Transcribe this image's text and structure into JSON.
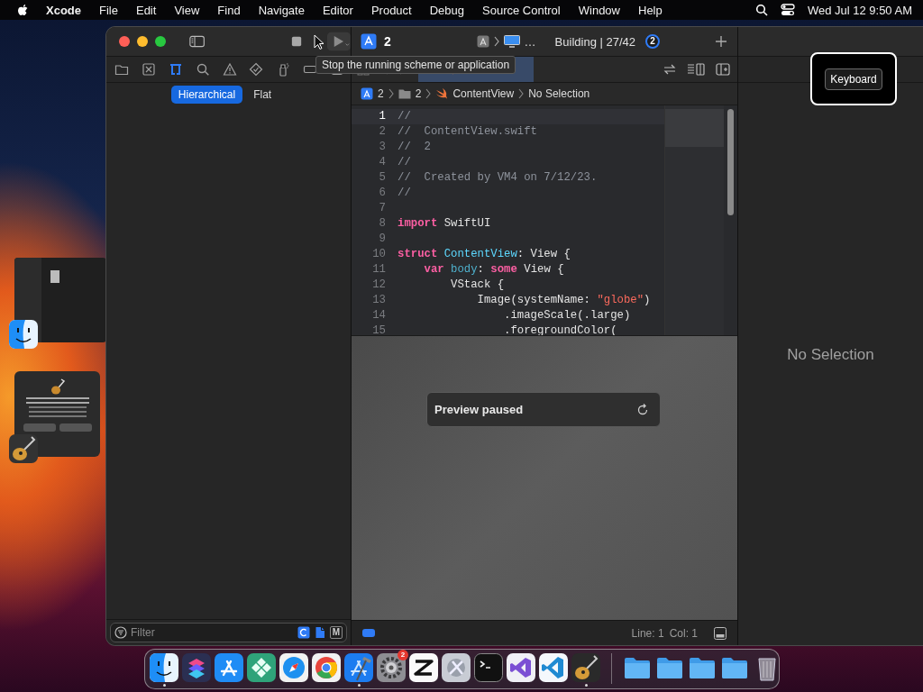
{
  "menu_bar": {
    "app": "Xcode",
    "items": [
      "File",
      "Edit",
      "View",
      "Find",
      "Navigate",
      "Editor",
      "Product",
      "Debug",
      "Source Control",
      "Window",
      "Help"
    ],
    "clock": "Wed Jul 12 9:50 AM"
  },
  "toolbar": {
    "scheme": "2",
    "destination": "…",
    "activity": "Building | 27/42",
    "activity_badge": "2",
    "tooltip": "Stop the running scheme or application"
  },
  "navigator": {
    "tabs": [
      {
        "selected": false
      },
      {
        "selected": false
      },
      {
        "selected": true
      },
      {
        "selected": false
      },
      {
        "selected": false
      },
      {
        "selected": false
      },
      {
        "selected": false
      },
      {
        "selected": false
      },
      {
        "selected": false
      }
    ],
    "modes": [
      {
        "label": "Hierarchical",
        "selected": true
      },
      {
        "label": "Flat",
        "selected": false
      }
    ],
    "filter": {
      "placeholder": "Filter",
      "toggles": [
        {
          "kind": "recent",
          "on": true
        },
        {
          "kind": "source",
          "on": true
        },
        {
          "kind": "scm",
          "label": "M",
          "on": false
        }
      ]
    }
  },
  "editor": {
    "breadcrumb": [
      "2",
      "2",
      "ContentView",
      "No Selection"
    ],
    "lines": [
      {
        "number": "1",
        "current": true,
        "tokens": [
          {
            "text": "//",
            "kind": "comment"
          }
        ]
      },
      {
        "number": "2",
        "current": false,
        "tokens": [
          {
            "text": "//  ContentView.swift",
            "kind": "comment"
          }
        ]
      },
      {
        "number": "3",
        "current": false,
        "tokens": [
          {
            "text": "//  2",
            "kind": "comment"
          }
        ]
      },
      {
        "number": "4",
        "current": false,
        "tokens": [
          {
            "text": "//",
            "kind": "comment"
          }
        ]
      },
      {
        "number": "5",
        "current": false,
        "tokens": [
          {
            "text": "//  Created by VM4 on 7/12/23.",
            "kind": "comment"
          }
        ]
      },
      {
        "number": "6",
        "current": false,
        "tokens": [
          {
            "text": "//",
            "kind": "comment"
          }
        ]
      },
      {
        "number": "7",
        "current": false
      },
      {
        "number": "8",
        "current": false,
        "tokens": [
          {
            "text": "import ",
            "kind": "keyword"
          },
          {
            "text": "SwiftUI",
            "kind": "plain"
          }
        ]
      },
      {
        "number": "9",
        "current": false
      },
      {
        "number": "10",
        "current": false,
        "tokens": [
          {
            "text": "struct ",
            "kind": "keyword"
          },
          {
            "text": "ContentView",
            "kind": "decl"
          },
          {
            "text": ": View {",
            "kind": "plain"
          }
        ]
      },
      {
        "number": "11",
        "current": false,
        "tokens": [
          {
            "text": "    var ",
            "kind": "keyword"
          },
          {
            "text": "body",
            "kind": "ident"
          },
          {
            "text": ": ",
            "kind": "plain"
          },
          {
            "text": "some",
            "kind": "keyword"
          },
          {
            "text": " View {",
            "kind": "plain"
          }
        ]
      },
      {
        "number": "12",
        "current": false,
        "tokens": [
          {
            "text": "        VStack {",
            "kind": "plain"
          }
        ]
      },
      {
        "number": "13",
        "current": false,
        "tokens": [
          {
            "text": "            Image(systemName: ",
            "kind": "plain"
          },
          {
            "text": "\"globe\"",
            "kind": "string"
          },
          {
            "text": ")",
            "kind": "plain"
          }
        ]
      },
      {
        "number": "14",
        "current": false,
        "tokens": [
          {
            "text": "                .imageScale(.large)",
            "kind": "plain"
          }
        ]
      },
      {
        "number": "15",
        "current": false,
        "tokens": [
          {
            "text": "                .foregroundColor(",
            "kind": "plain"
          }
        ]
      }
    ],
    "status": {
      "line": "Line: 1",
      "col": "Col: 1"
    }
  },
  "preview": {
    "message": "Preview paused"
  },
  "inspector": {
    "message": "No Selection"
  },
  "keyboard_overlay": {
    "label": "Keyboard"
  },
  "dock": [
    {
      "kind": "app",
      "running": true
    },
    {
      "kind": "app",
      "running": false
    },
    {
      "kind": "app",
      "running": false
    },
    {
      "kind": "app",
      "running": false
    },
    {
      "kind": "app",
      "running": false
    },
    {
      "kind": "app",
      "running": false
    },
    {
      "kind": "app",
      "running": true
    },
    {
      "kind": "app",
      "running": false,
      "badge": "2"
    },
    {
      "kind": "app",
      "running": false
    },
    {
      "kind": "app",
      "running": false
    },
    {
      "kind": "app",
      "running": false
    },
    {
      "kind": "app",
      "running": false
    },
    {
      "kind": "app",
      "running": false
    },
    {
      "kind": "app",
      "running": true
    },
    {
      "kind": "folder",
      "running": false
    },
    {
      "kind": "folder",
      "running": false
    },
    {
      "kind": "folder",
      "running": false
    },
    {
      "kind": "folder",
      "running": false
    },
    {
      "kind": "trash",
      "running": false
    }
  ]
}
